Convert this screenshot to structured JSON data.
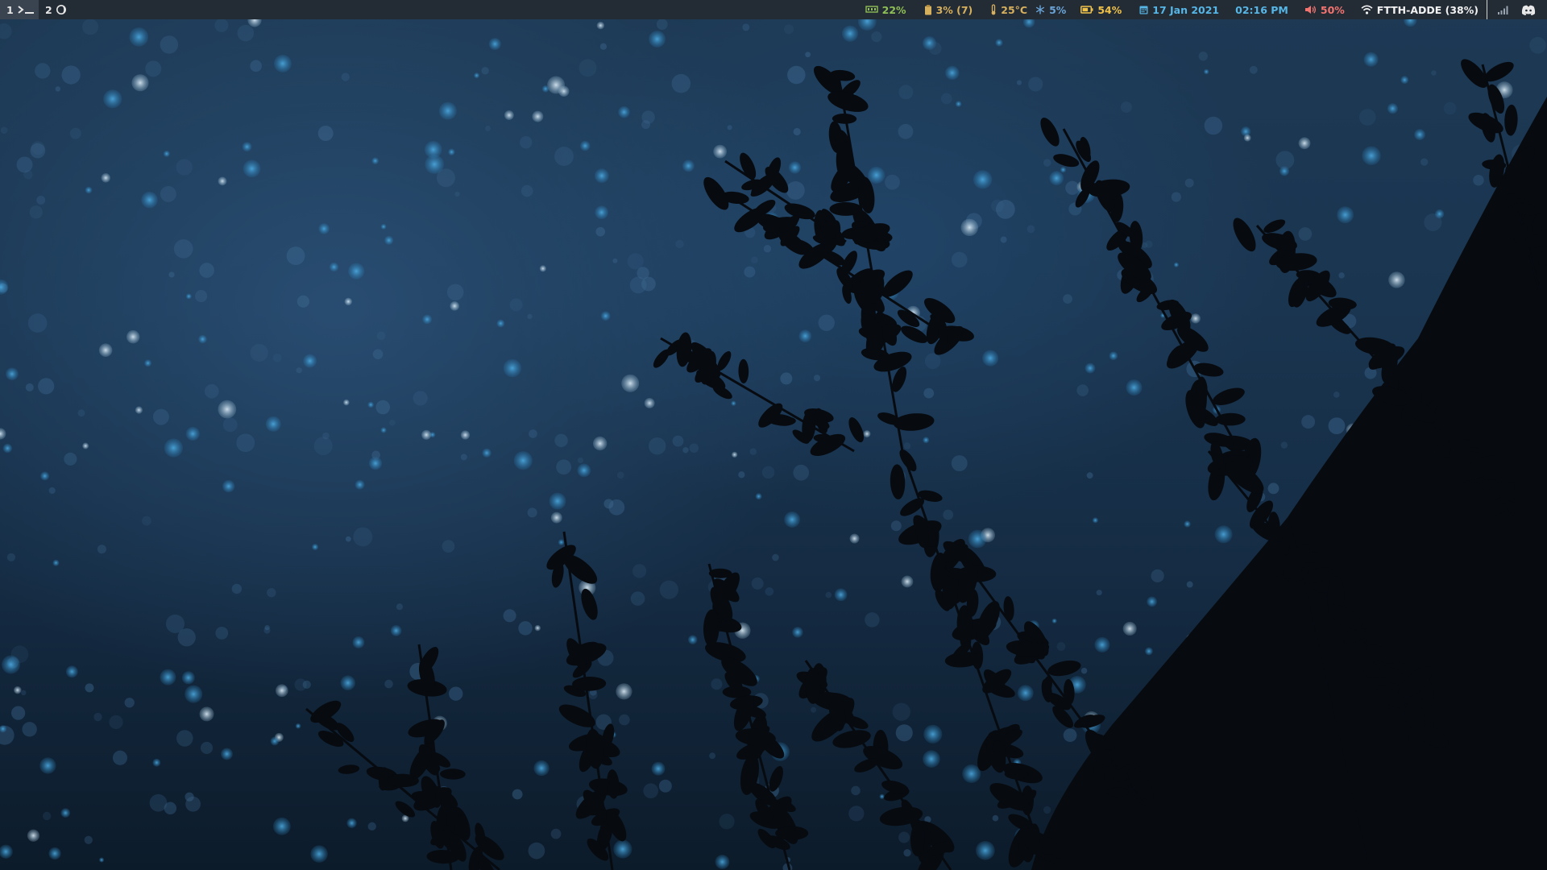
{
  "workspaces": [
    {
      "number": "1",
      "icon": "terminal-icon",
      "active": true
    },
    {
      "number": "2",
      "icon": "moon-icon",
      "active": false
    }
  ],
  "status": {
    "cpu": {
      "icon": "memory-chip-icon",
      "value": "22%",
      "color": "#8fbf56"
    },
    "memory": {
      "icon": "clipboard-icon",
      "value": "3% (7)",
      "color": "#d7b05e"
    },
    "temperature": {
      "icon": "thermometer-icon",
      "value": "25°C",
      "color": "#d7b05e"
    },
    "fan": {
      "icon": "snowflake-icon",
      "value": "5%",
      "color": "#6aa4d8"
    },
    "battery": {
      "icon": "battery-icon",
      "value": "54%",
      "color": "#f0c24a"
    },
    "date": {
      "icon": "calendar-icon",
      "value": "17 Jan 2021",
      "color": "#56b6e6"
    },
    "clock": {
      "value": "02:16 PM",
      "color": "#56b6e6"
    },
    "volume": {
      "icon": "speaker-icon",
      "value": "50%",
      "color": "#f27470"
    },
    "wifi": {
      "icon": "wifi-icon",
      "value": "FTTH-ADDE (38%)",
      "color": "#f2f2f2"
    }
  },
  "tray": [
    {
      "icon": "network-signal-icon"
    },
    {
      "icon": "discord-icon"
    }
  ],
  "colors": {
    "bar_background": "#232b34",
    "active_workspace": "#3a4450"
  }
}
